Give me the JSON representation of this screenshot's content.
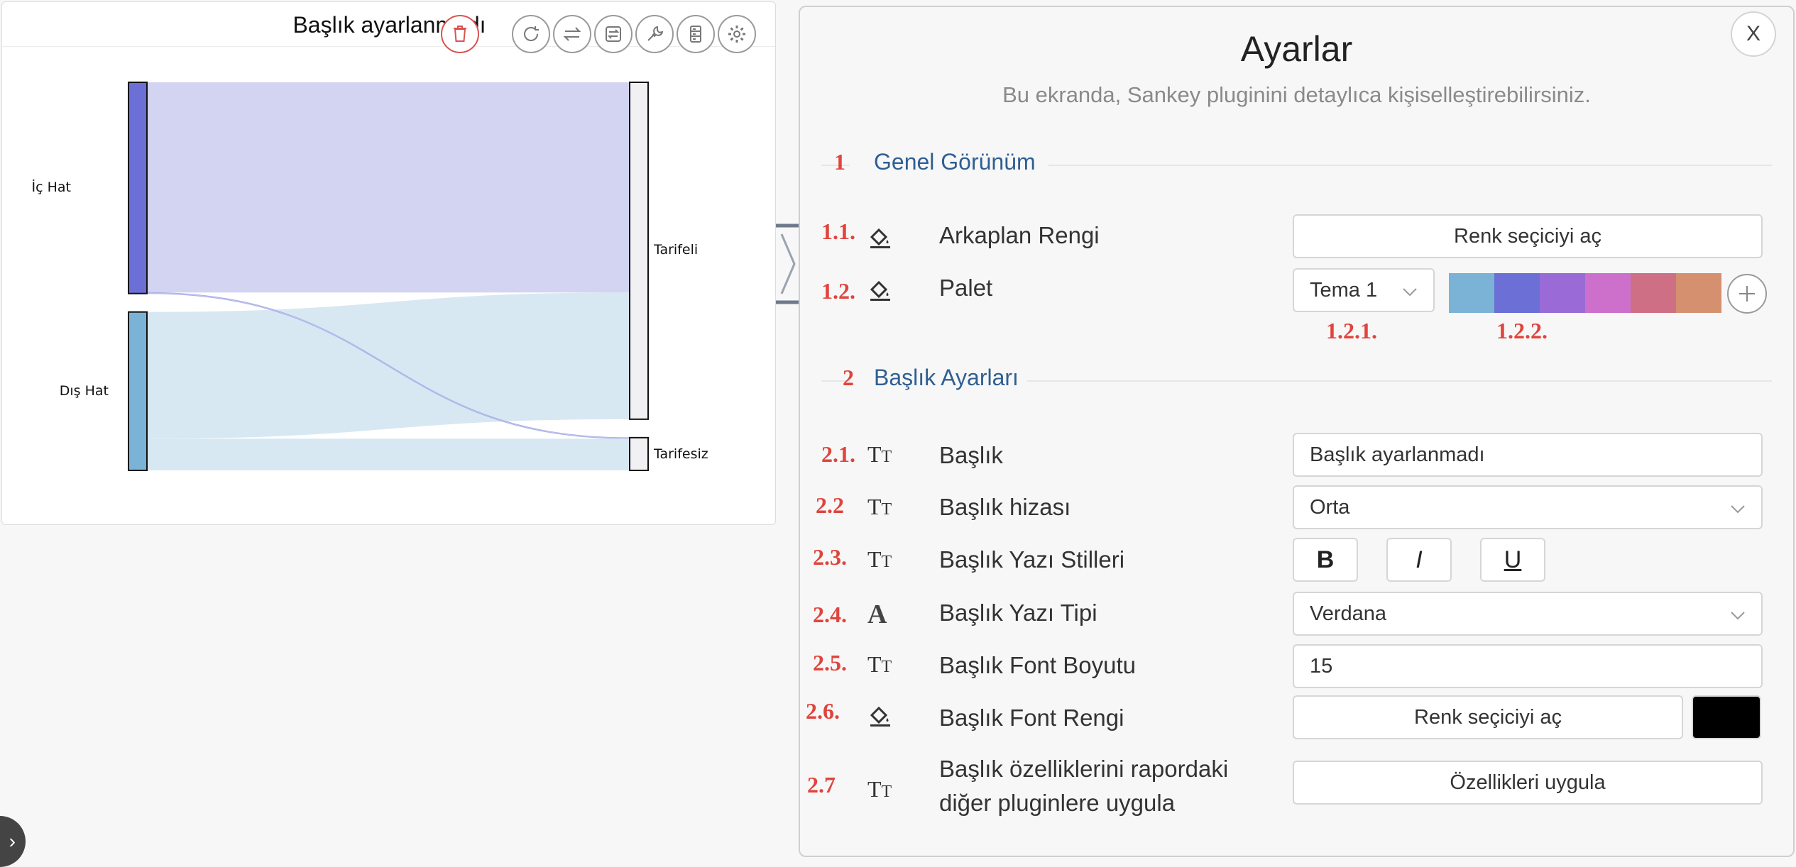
{
  "chart": {
    "title": "Başlık ayarlanmadı",
    "toolbar": [
      "delete-icon",
      "refresh-icon",
      "swap-icon",
      "switch-icon",
      "wrench-icon",
      "data-icon",
      "gear-icon"
    ],
    "node_labels": {
      "ic_hat": "İç Hat",
      "dis_hat": "Dış Hat",
      "tarifeli": "Tarifeli",
      "tarifesiz": "Tarifesiz"
    }
  },
  "chart_data": {
    "type": "sankey",
    "title": "Başlık ayarlanmadı",
    "nodes": [
      "İç Hat",
      "Dış Hat",
      "Tarifeli",
      "Tarifesiz"
    ],
    "links": [
      {
        "source": "İç Hat",
        "target": "Tarifeli",
        "value": 0.995
      },
      {
        "source": "İç Hat",
        "target": "Tarifesiz",
        "value": 0.005
      },
      {
        "source": "Dış Hat",
        "target": "Tarifeli",
        "value": 0.6
      },
      {
        "source": "Dış Hat",
        "target": "Tarifesiz",
        "value": 0.15
      }
    ],
    "colors": {
      "İç Hat": "#6b6fd6",
      "Dış Hat": "#7ab3d6",
      "Tarifeli": "#f1f1f3",
      "Tarifesiz": "#f1f1f3"
    }
  },
  "panel": {
    "close_label": "X",
    "title": "Ayarlar",
    "subtitle": "Bu ekranda, Sankey pluginini detaylıca kişiselleştirebilirsiniz.",
    "sections": [
      {
        "num": "1",
        "title": "Genel Görünüm"
      },
      {
        "num": "2",
        "title": "Başlık Ayarları"
      }
    ],
    "rows": {
      "bg_color": {
        "ann": "1.1.",
        "label": "Arkaplan Rengi",
        "button": "Renk seçiciyi aç"
      },
      "palette": {
        "ann": "1.2.",
        "label": "Palet",
        "select": "Tema 1",
        "ann_select": "1.2.1.",
        "ann_swatches": "1.2.2.",
        "swatches": [
          "#7ab3d6",
          "#6b6fd6",
          "#9a6bd6",
          "#cc70cc",
          "#cf6f86",
          "#d59070"
        ]
      },
      "title": {
        "ann": "2.1.",
        "label": "Başlık",
        "value": "Başlık ayarlanmadı"
      },
      "align": {
        "ann": "2.2",
        "label": "Başlık hizası",
        "value": "Orta"
      },
      "styles": {
        "ann": "2.3.",
        "label": "Başlık Yazı Stilleri",
        "bold": "B",
        "italic": "I",
        "underline": "U"
      },
      "font": {
        "ann": "2.4.",
        "label": "Başlık Yazı Tipi",
        "value": "Verdana"
      },
      "size": {
        "ann": "2.5.",
        "label": "Başlık Font Boyutu",
        "value": "15"
      },
      "fcolor": {
        "ann": "2.6.",
        "label": "Başlık Font Rengi",
        "button": "Renk seçiciyi aç",
        "preview_color": "#000000"
      },
      "apply": {
        "ann": "2.7",
        "label_line1": "Başlık özelliklerini rapordaki",
        "label_line2": "diğer pluginlere uygula",
        "button": "Özellikleri uygula"
      }
    }
  }
}
